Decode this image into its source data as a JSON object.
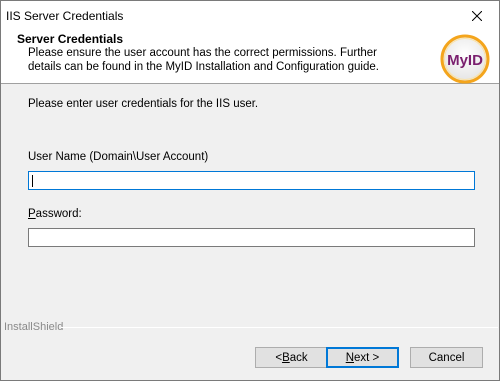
{
  "window": {
    "title": "IIS Server Credentials"
  },
  "header": {
    "title": "Server Credentials",
    "description": "Please ensure the user account has the correct permissions. Further details can be found in the MyID Installation and Configuration guide.",
    "logo_text": "MyID"
  },
  "form": {
    "prompt": "Please enter user credentials for the IIS user.",
    "username_label": "User Name (Domain\\User Account)",
    "username_value": "",
    "password_label_access": "P",
    "password_label_rest": "assword:",
    "password_value": ""
  },
  "footer": {
    "brand": "InstallShield",
    "back_access": "B",
    "back_prefix": "< ",
    "back_rest": "ack",
    "next_access": "N",
    "next_rest": "ext >",
    "cancel": "Cancel"
  }
}
